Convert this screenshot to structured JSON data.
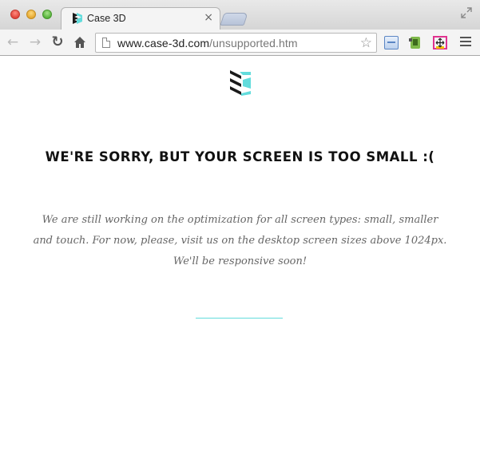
{
  "browser": {
    "tab": {
      "title": "Case 3D"
    },
    "toolbar": {
      "url_domain": "www.case-3d.com",
      "url_path": "/unsupported.htm"
    }
  },
  "page": {
    "heading": "WE'RE SORRY, BUT YOUR SCREEN IS TOO SMALL :(",
    "message": "We are still working on the optimization for all screen types: small, smaller and touch. For now, please, visit us on the desktop screen sizes above 1024px. We'll be responsive soon!"
  },
  "colors": {
    "accent": "#62dcdc",
    "logo_dark": "#1a1a1a"
  },
  "icons": [
    "close-icon",
    "minimize-icon",
    "zoom-icon",
    "fullscreen-icon",
    "back-arrow-icon",
    "forward-arrow-icon",
    "reload-icon",
    "home-icon",
    "page-icon",
    "star-icon",
    "extension-icon",
    "menu-icon",
    "case3d-logo-icon"
  ]
}
